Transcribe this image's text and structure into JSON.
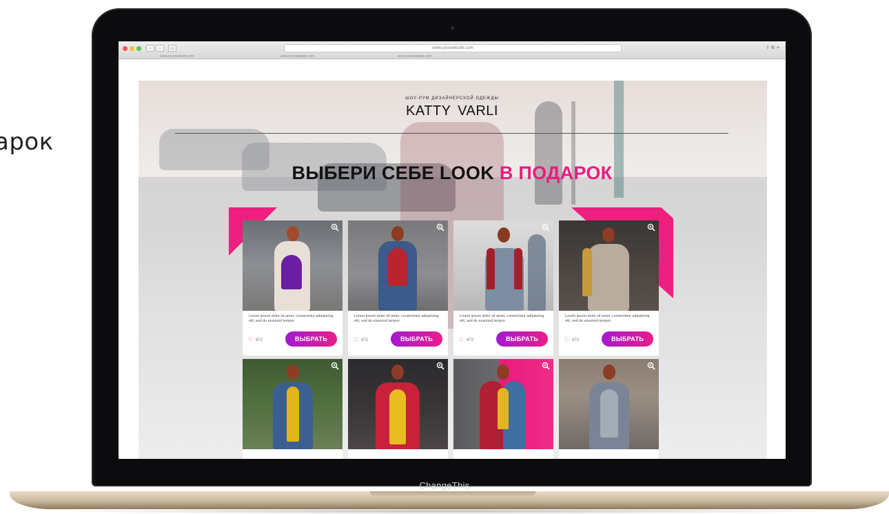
{
  "side_text": "арок",
  "bezel_label": "ChangeThis",
  "browser": {
    "url": "www.yourwebsite.com",
    "tabs": [
      "www.yourwebsite.com",
      "www.yourwebsite.com",
      "www.yourwebsite.com"
    ]
  },
  "page": {
    "brand_subtitle": "ШОУ-РУМ ДИЗАЙНЕРСКОЙ ОДЕЖДЫ",
    "brand_name": "KATTY  VARLI",
    "headline_dark": "ВЫБЕРИ СЕБЕ LOOK",
    "headline_pink": "В ПОДАРОК",
    "accent_color": "#ea1b7e",
    "button_gradient": [
      "#a21ad0",
      "#e91e89"
    ]
  },
  "cards": [
    {
      "description": "Lorem ipsum dolor sit amet, consectetur adipisicing elit, sed do eiusmod tempor",
      "likes": "672",
      "button": "ВЫБРАТЬ",
      "icon": "zoom-icon"
    },
    {
      "description": "Lorem ipsum dolor sit amet, consectetur adipisicing elit, sed do eiusmod tempor",
      "likes": "672",
      "button": "ВЫБРАТЬ",
      "icon": "zoom-icon"
    },
    {
      "description": "Lorem ipsum dolor sit amet, consectetur adipisicing elit, sed do eiusmod tempor",
      "likes": "672",
      "button": "ВЫБРАТЬ",
      "icon": "zoom-icon"
    },
    {
      "description": "Lorem ipsum dolor sit amet, consectetur adipisicing elit, sed do eiusmod tempor",
      "likes": "672",
      "button": "ВЫБРАТЬ",
      "icon": "zoom-icon"
    }
  ]
}
